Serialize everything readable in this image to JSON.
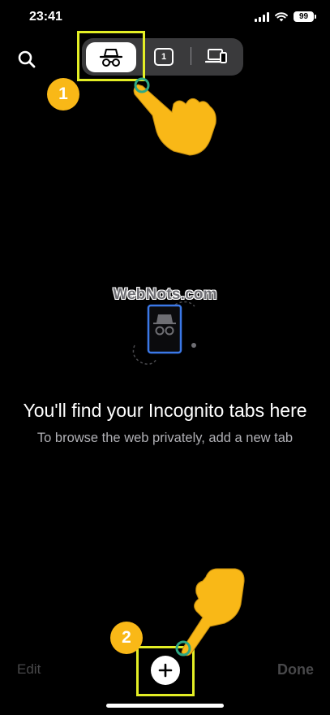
{
  "status_bar": {
    "time": "23:41",
    "battery": "99"
  },
  "tab_switcher": {
    "regular_tab_count": "1"
  },
  "watermark": "WebNots.com",
  "empty_state": {
    "title": "You'll find your Incognito tabs here",
    "subtitle": "To browse the web privately, add a new tab"
  },
  "bottom_bar": {
    "edit_label": "Edit",
    "done_label": "Done"
  },
  "annotations": {
    "step_1": "1",
    "step_2": "2"
  },
  "icons": {
    "search": "search-icon",
    "incognito": "incognito-icon",
    "regular_tabs": "tab-count-icon",
    "devices": "devices-icon",
    "new_tab": "plus-icon"
  },
  "colors": {
    "highlight": "#e3ee25",
    "badge": "#f9b817",
    "hand": "#f9b817",
    "hand_ring": "#2ea884",
    "illustration_accent": "#3b78e7",
    "disabled_text": "#48484a"
  }
}
